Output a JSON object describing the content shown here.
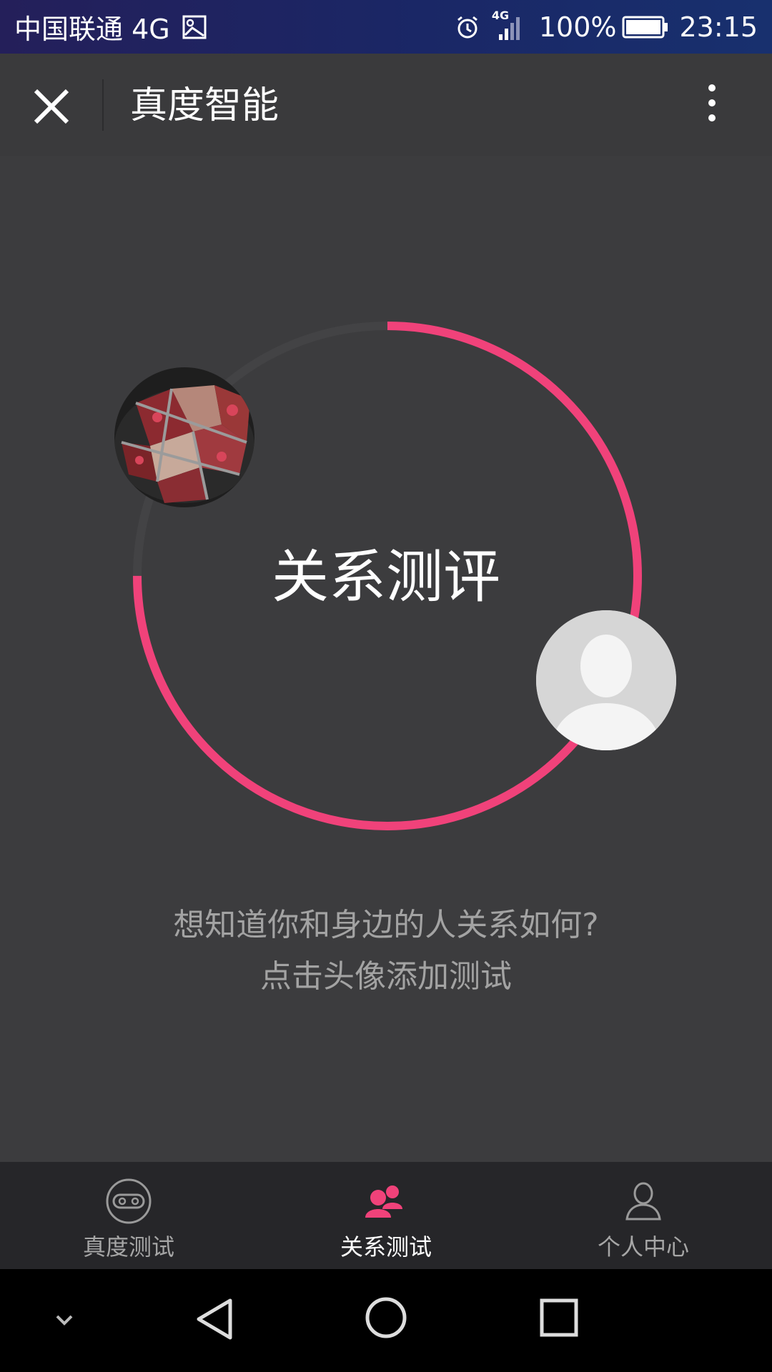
{
  "status_bar": {
    "carrier": "中国联通 4G",
    "network_small": "4G",
    "battery": "100%",
    "time": "23:15"
  },
  "header": {
    "title": "真度智能"
  },
  "main": {
    "title": "关系测评",
    "progress_fraction": 0.75,
    "hint_line1": "想知道你和身边的人关系如何?",
    "hint_line2": "点击头像添加测试"
  },
  "tabs": [
    {
      "label": "真度测试",
      "icon": "mask-icon",
      "active": false
    },
    {
      "label": "关系测试",
      "icon": "people-icon",
      "active": true
    },
    {
      "label": "个人中心",
      "icon": "user-icon",
      "active": false
    }
  ],
  "colors": {
    "accent": "#f0427a",
    "background": "#3c3c3e",
    "tabbar": "#262629"
  }
}
